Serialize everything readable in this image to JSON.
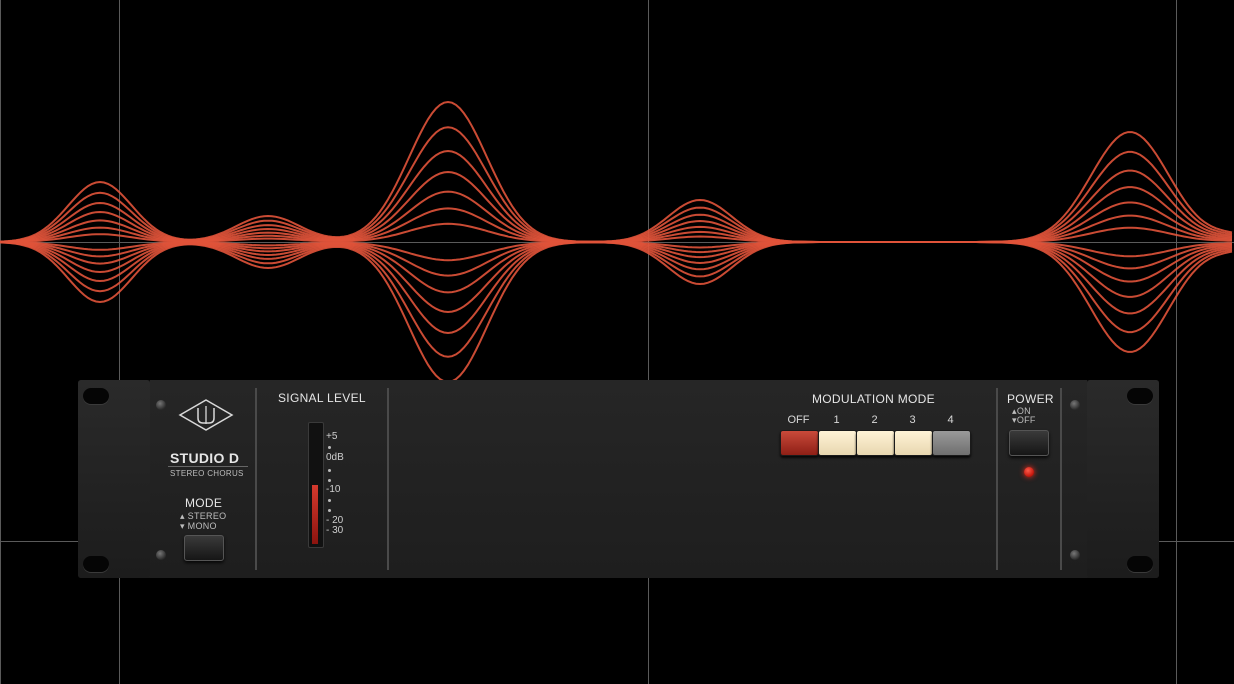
{
  "device": {
    "name": "STUDIO D",
    "subtitle": "STEREO CHORUS"
  },
  "mode": {
    "label": "MODE",
    "option_up": "STEREO",
    "option_down": "MONO"
  },
  "signal_level": {
    "label": "SIGNAL LEVEL",
    "ticks": [
      "+5",
      "0dB",
      "-10",
      "- 20",
      "- 30"
    ],
    "fill_fraction": 0.5
  },
  "modulation": {
    "label": "MODULATION MODE",
    "options": [
      "OFF",
      "1",
      "2",
      "3",
      "4"
    ],
    "selected": "OFF"
  },
  "power": {
    "label": "POWER",
    "option_on": "ON",
    "option_off": "OFF",
    "state": "on"
  },
  "colors": {
    "wave": "#e0533a",
    "led": "#ff2a1a",
    "off_button": "#b8352a",
    "cream_button": "#f6e6c2",
    "grey_button": "#8a8a8a"
  },
  "icons": {
    "logo": "ua-logo-icon"
  }
}
